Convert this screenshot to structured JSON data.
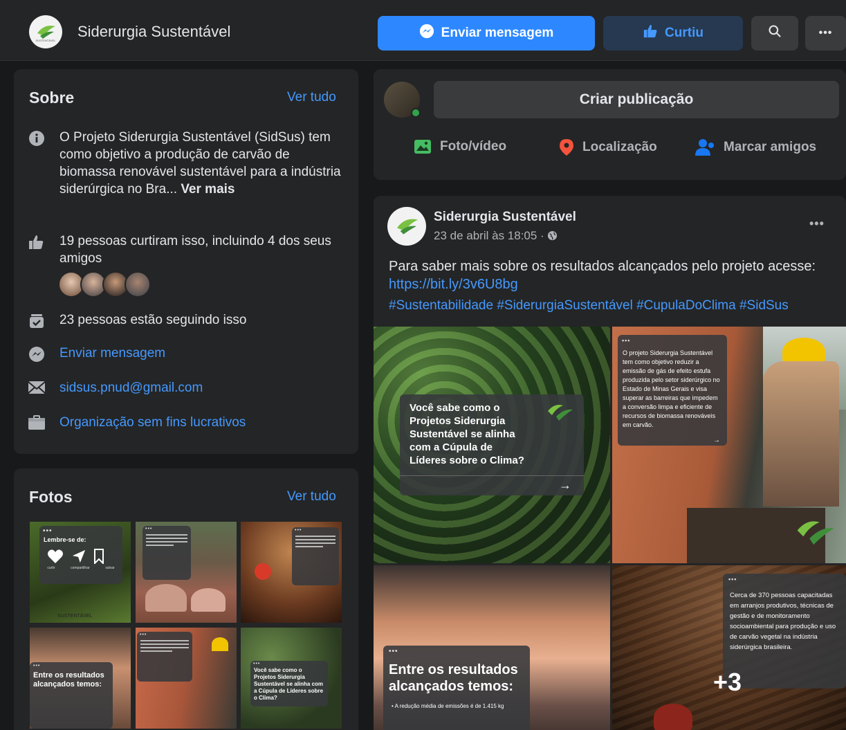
{
  "header": {
    "page_name": "Siderurgia Sustentável",
    "logo_text": "SUSTENTÁVEL",
    "send_message_label": "Enviar mensagem",
    "liked_label": "Curtiu"
  },
  "about": {
    "title": "Sobre",
    "see_all": "Ver tudo",
    "description": "O Projeto Siderurgia Sustentável (SidSus) tem como objetivo a produção de carvão de biomassa renovável sustentável para a indústria siderúrgica no Bra...",
    "see_more": "Ver mais",
    "likes_text": "19 pessoas curtiram isso, incluindo 4 dos seus amigos",
    "followers_text": "23 pessoas estão seguindo isso",
    "message_link": "Enviar mensagem",
    "email": "sidsus.pnud@gmail.com",
    "category": "Organização sem fins lucrativos"
  },
  "photos": {
    "title": "Fotos",
    "see_all": "Ver tudo",
    "thumb1_title": "Lembre-se de:",
    "thumb1_actions": [
      "curtir",
      "compartilhar",
      "salvar"
    ],
    "thumb1_footer": "SUSTENTÁVEL",
    "thumb5_text": "Entre os resultados alcançados temos:",
    "thumb6_text": "Você sabe como o Projetos Siderurgia Sustentável se alinha com a Cúpula de Líderes sobre o Clima?"
  },
  "create_post": {
    "button_label": "Criar publicação",
    "photo_video": "Foto/vídeo",
    "location": "Localização",
    "tag_friends": "Marcar amigos"
  },
  "post": {
    "author": "Siderurgia Sustentável",
    "timestamp": "23 de abril às 18:05 ·",
    "text": "Para saber mais sobre os resultados alcançados pelo projeto acesse:",
    "link": "https://bit.ly/3v6U8bg",
    "hashtags": "#Sustentabilidade #SiderurgiaSustentável #CupulaDoClima #SidSus",
    "image1_text": "Você sabe como o Projetos Siderurgia Sustentável se alinha com a Cúpula de Líderes sobre o Clima?",
    "image2_text": "O projeto Siderurgia Sustentável tem como objetivo reduzir a emissão de gás de efeito estufa produzida pelo setor siderúrgico no Estado de Minas Gerais e visa superar as barreiras que impedem a conversão limpa e eficiente de recursos de biomassa renováveis em carvão.",
    "image3_title": "Entre os resultados alcançados temos:",
    "image3_bullet": "A redução média de emissões é de 1.415 kg",
    "image4_text": "Cerca de 370 pessoas capacitadas em arranjos produtivos, técnicas de gestão e de monitoramento socioambiental para produção e uso de carvão vegetal na indústria siderúrgica brasileira.",
    "more_count": "+3"
  },
  "colors": {
    "background": "#18191a",
    "card": "#242526",
    "accent": "#2d88ff",
    "link": "#4599ff"
  }
}
